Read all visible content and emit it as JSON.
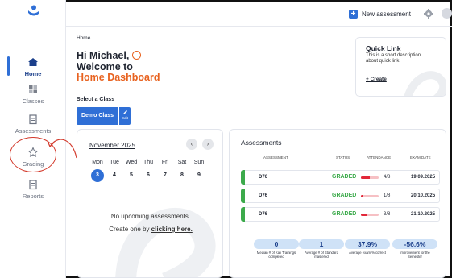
{
  "sidebar": {
    "items": [
      {
        "label": "Home",
        "icon": "home-icon"
      },
      {
        "label": "Classes",
        "icon": "grid-icon"
      },
      {
        "label": "Assessments",
        "icon": "clipboard-icon"
      },
      {
        "label": "Grading",
        "icon": "star-icon"
      },
      {
        "label": "Reports",
        "icon": "document-icon"
      }
    ]
  },
  "topbar": {
    "new_assessment": "New assessment"
  },
  "breadcrumb": "Home",
  "greeting": {
    "line1": "Hi Michael,",
    "line2": "Welcome to",
    "line3": "Home Dashboard"
  },
  "class_select": {
    "label": "Select a Class",
    "class_name": "Demo Class",
    "edit_label": "Edit"
  },
  "quick_link": {
    "title": "Quick Link",
    "description": "This is a short description about quick link.",
    "action": "+ Create"
  },
  "calendar": {
    "month": "November 2025",
    "weekdays": [
      "Mon",
      "Tue",
      "Wed",
      "Thu",
      "Fri",
      "Sat",
      "Sun"
    ],
    "days": [
      "3",
      "4",
      "5",
      "6",
      "7",
      "8",
      "9"
    ],
    "today": "3",
    "empty_line1": "No upcoming assessments.",
    "empty_prefix": "Create one by ",
    "empty_link": "clicking here."
  },
  "assessments": {
    "title": "Assessments",
    "columns": [
      "ASSESSMENT",
      "STATUS",
      "ATTENDANCE",
      "EXAM DATE"
    ],
    "rows": [
      {
        "name": "D76",
        "status": "GRADED",
        "attendance": "4/8",
        "attendance_fraction": 0.5,
        "date": "19.09.2025"
      },
      {
        "name": "D76",
        "status": "GRADED",
        "attendance": "1/8",
        "attendance_fraction": 0.125,
        "date": "20.10.2025"
      },
      {
        "name": "D76",
        "status": "GRADED",
        "attendance": "3/8",
        "attendance_fraction": 0.375,
        "date": "21.10.2025"
      }
    ],
    "stats": [
      {
        "value": "0",
        "caption": "Median # of Kali Trainings completed"
      },
      {
        "value": "1",
        "caption": "Average # of Standard mastered"
      },
      {
        "value": "37.9%",
        "caption": "Average exam % correct"
      },
      {
        "value": "-56.6%",
        "caption": "Improvement for the Semester"
      }
    ]
  },
  "colors": {
    "accent": "#2f6fd6",
    "brand_orange": "#e8621f",
    "graded": "#3caa4b",
    "annotation": "#d33a2c"
  }
}
